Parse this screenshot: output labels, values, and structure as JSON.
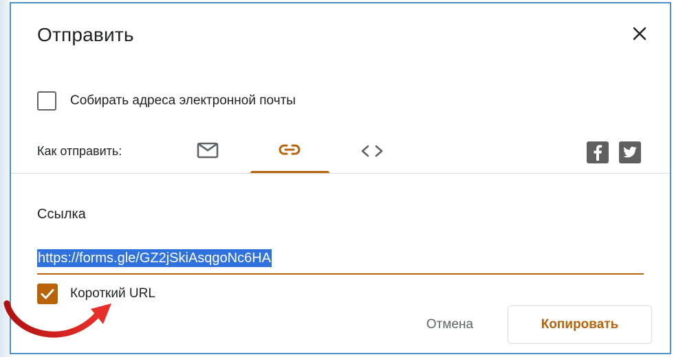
{
  "dialog": {
    "title": "Отправить",
    "close_icon": "close-icon"
  },
  "collect_emails": {
    "label": "Собирать адреса электронной почты",
    "checked": false
  },
  "send_via": {
    "label": "Как отправить:",
    "tabs": [
      {
        "icon": "email-icon",
        "selected": false
      },
      {
        "icon": "link-icon",
        "selected": true
      },
      {
        "icon": "embed-code-icon",
        "selected": false
      }
    ],
    "social": [
      {
        "icon": "facebook-icon"
      },
      {
        "icon": "twitter-icon"
      }
    ]
  },
  "link_section": {
    "title": "Ссылка",
    "url": "https://forms.gle/GZ2jSkiAsqgoNc6HA",
    "short_url_label": "Короткий URL",
    "short_url_checked": true
  },
  "actions": {
    "cancel_label": "Отмена",
    "copy_label": "Копировать"
  },
  "colors": {
    "accent": "#b8620a",
    "selection": "#2f72de",
    "annotation_arrow": "#d6281e"
  }
}
